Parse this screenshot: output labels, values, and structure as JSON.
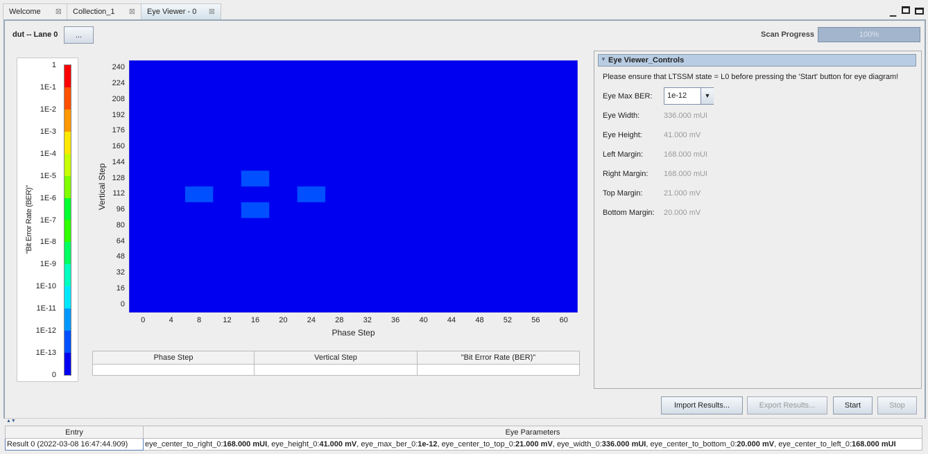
{
  "tabs": [
    {
      "label": "Welcome"
    },
    {
      "label": "Collection_1"
    },
    {
      "label": "Eye Viewer - 0",
      "active": true
    }
  ],
  "window_icons": [
    "minimize-icon",
    "detach-icon",
    "maximize-icon"
  ],
  "header": {
    "device_label": "dut -- Lane 0",
    "browse_button": "...",
    "progress_label": "Scan Progress",
    "progress_text": "100%",
    "progress_value": 100
  },
  "colorbar": {
    "title": "\"Bit Error Rate (BER)\"",
    "labels": [
      "1",
      "1E-1",
      "1E-2",
      "1E-3",
      "1E-4",
      "1E-5",
      "1E-6",
      "1E-7",
      "1E-8",
      "1E-9",
      "1E-10",
      "1E-11",
      "1E-12",
      "1E-13",
      "0"
    ],
    "colors": [
      "#ff0000",
      "#ff5000",
      "#ff9800",
      "#ffe800",
      "#c8ff00",
      "#80ff00",
      "#00ff30",
      "#30ff00",
      "#00ff60",
      "#00ffc0",
      "#00e8ff",
      "#0098ff",
      "#0050ff",
      "#0000f0"
    ]
  },
  "chart_data": {
    "type": "heatmap",
    "xlabel": "Phase Step",
    "ylabel": "Vertical Step",
    "x_ticks": [
      0,
      4,
      8,
      12,
      16,
      20,
      24,
      28,
      32,
      36,
      40,
      44,
      48,
      52,
      56,
      60
    ],
    "y_ticks": [
      0,
      16,
      32,
      48,
      64,
      80,
      96,
      112,
      128,
      144,
      160,
      176,
      192,
      208,
      224,
      240
    ],
    "xlim": [
      -2,
      62
    ],
    "ylim": [
      -8,
      248
    ],
    "cell_size": {
      "x": 4,
      "y": 16
    },
    "background_color": "#0000f0",
    "cells": [
      {
        "x": 8,
        "y": 112,
        "color": "#0050ff"
      },
      {
        "x": 16,
        "y": 128,
        "color": "#0050ff"
      },
      {
        "x": 16,
        "y": 96,
        "color": "#0050ff"
      },
      {
        "x": 24,
        "y": 112,
        "color": "#0050ff"
      }
    ]
  },
  "point_table": {
    "headers": [
      "Phase Step",
      "Vertical Step",
      "\"Bit Error Rate (BER)\""
    ],
    "row": [
      "",
      "",
      ""
    ]
  },
  "controls": {
    "title": "Eye Viewer_Controls",
    "notice": "Please ensure that LTSSM state = L0 before pressing the 'Start' button for eye diagram!",
    "max_ber_label": "Eye Max BER:",
    "max_ber_value": "1e-12",
    "fields": [
      {
        "label": "Eye Width:",
        "value": "336.000 mUI"
      },
      {
        "label": "Eye Height:",
        "value": "41.000 mV"
      },
      {
        "label": "Left Margin:",
        "value": "168.000 mUI"
      },
      {
        "label": "Right Margin:",
        "value": "168.000 mUI"
      },
      {
        "label": "Top Margin:",
        "value": "21.000 mV"
      },
      {
        "label": "Bottom Margin:",
        "value": "20.000 mV"
      }
    ]
  },
  "buttons": {
    "import": "Import Results...",
    "export": "Export Results...",
    "start": "Start",
    "stop": "Stop"
  },
  "results": {
    "headers": [
      "Entry",
      "Eye Parameters"
    ],
    "rows": [
      {
        "entry": "Result 0 (2022-03-08 16:47:44.909)",
        "params": [
          [
            "eye_center_to_right_0:",
            "168.000 mUI"
          ],
          [
            "eye_height_0:",
            "41.000 mV"
          ],
          [
            "eye_max_ber_0:",
            "1e-12"
          ],
          [
            "eye_center_to_top_0:",
            "21.000 mV"
          ],
          [
            "eye_width_0:",
            "336.000 mUI"
          ],
          [
            "eye_center_to_bottom_0:",
            "20.000 mV"
          ],
          [
            "eye_center_to_left_0:",
            "168.000 mUI"
          ]
        ]
      }
    ]
  }
}
